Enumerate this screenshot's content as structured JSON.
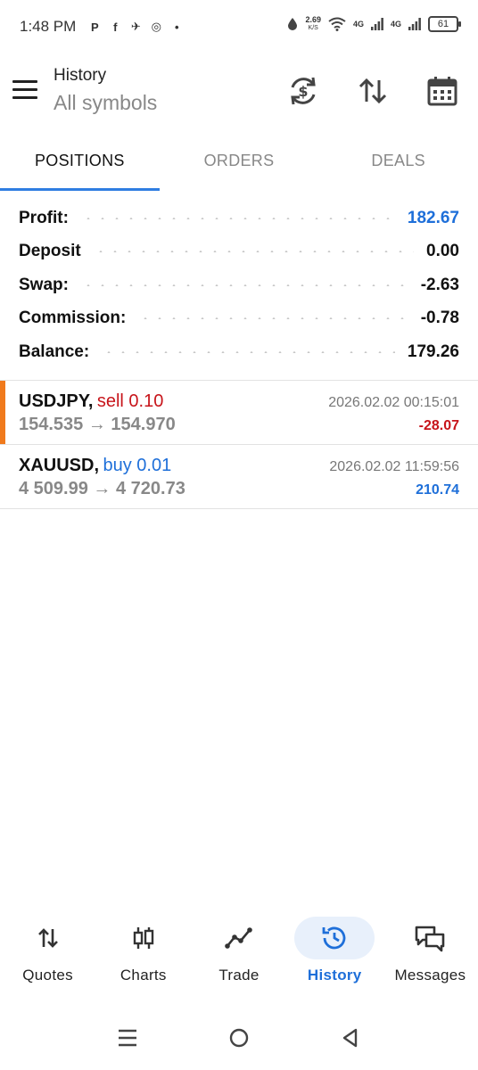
{
  "status_bar": {
    "time": "1:48 PM",
    "notifications": [
      "P",
      "f",
      "✈",
      "◎",
      "•"
    ],
    "net_speed": "2.69",
    "net_unit": "K/S",
    "signal1": "4G",
    "signal2": "4G",
    "battery": "61"
  },
  "app_bar": {
    "title": "History",
    "subtitle": "All symbols",
    "actions": [
      "currency-sync-icon",
      "sort-icon",
      "calendar-icon"
    ]
  },
  "tabs": [
    {
      "label": "POSITIONS",
      "active": true
    },
    {
      "label": "ORDERS",
      "active": false
    },
    {
      "label": "DEALS",
      "active": false
    }
  ],
  "summary": [
    {
      "label": "Profit:",
      "value": "182.67",
      "highlight": true
    },
    {
      "label": "Deposit",
      "value": "0.00",
      "highlight": false
    },
    {
      "label": "Swap:",
      "value": "-2.63",
      "highlight": false
    },
    {
      "label": "Commission:",
      "value": "-0.78",
      "highlight": false
    },
    {
      "label": "Balance:",
      "value": "179.26",
      "highlight": false
    }
  ],
  "deals": [
    {
      "symbol": "USDJPY,",
      "type": "sell 0.10",
      "side": "sell",
      "time": "2026.02.02 00:15:01",
      "prices": "154.535 → 154.970",
      "profit": "-28.07",
      "accent_color": "#f07a1c"
    },
    {
      "symbol": "XAUUSD,",
      "type": "buy 0.01",
      "side": "buy",
      "time": "2026.02.02 11:59:56",
      "prices": "4 509.99 → 4 720.73",
      "profit": "210.74"
    }
  ],
  "bottom_nav": [
    {
      "label": "Quotes",
      "icon": "quotes-arrows-icon",
      "active": false
    },
    {
      "label": "Charts",
      "icon": "candlestick-icon",
      "active": false
    },
    {
      "label": "Trade",
      "icon": "trade-line-icon",
      "active": false
    },
    {
      "label": "History",
      "icon": "history-clock-icon",
      "active": true
    },
    {
      "label": "Messages",
      "icon": "chat-bubbles-icon",
      "active": false
    }
  ],
  "colors": {
    "accent_blue": "#1e6fd9",
    "tab_indicator": "#2f7de1",
    "loss_red": "#c7141a",
    "sell_accent": "#f07a1c"
  }
}
